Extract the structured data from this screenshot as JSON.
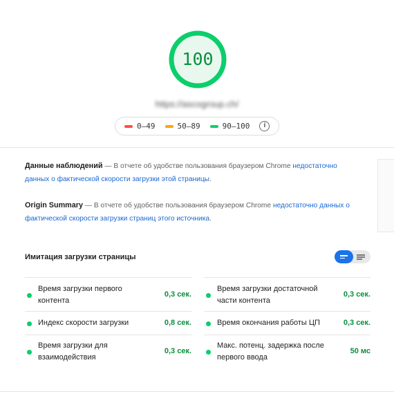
{
  "score": {
    "value": "100",
    "color": "#0cce6b"
  },
  "url": "https://ascogroup.ch/",
  "legend": {
    "fail": {
      "label": "0–49",
      "color": "#ff4e42"
    },
    "average": {
      "label": "50–89",
      "color": "#ffa400"
    },
    "pass": {
      "label": "90–100",
      "color": "#0cce6b"
    },
    "info_glyph": "i"
  },
  "field_data": {
    "title": "Данные наблюдений",
    "dash": "—",
    "text": "В отчете об удобстве пользования браузером Chrome",
    "link": "недостаточно данных о фактической скорости загрузки этой страницы",
    "period": "."
  },
  "origin_summary": {
    "title": "Origin Summary",
    "dash": "—",
    "text": "В отчете об удобстве пользования браузером Chrome",
    "link": "недостаточно данных о фактической скорости загрузки страниц этого источника",
    "period": "."
  },
  "lab": {
    "title": "Имитация загрузки страницы",
    "metrics_left": [
      {
        "label": "Время загрузки первого контента",
        "value": "0,3 сек."
      },
      {
        "label": "Индекс скорости загрузки",
        "value": "0,8 сек."
      },
      {
        "label": "Время загрузки для взаимодействия",
        "value": "0,3 сек."
      }
    ],
    "metrics_right": [
      {
        "label": "Время загрузки достаточной части контента",
        "value": "0,3 сек."
      },
      {
        "label": "Время окончания работы ЦП",
        "value": "0,3 сек."
      },
      {
        "label": "Макс. потенц. задержка после первого ввода",
        "value": "50 мс"
      }
    ]
  }
}
